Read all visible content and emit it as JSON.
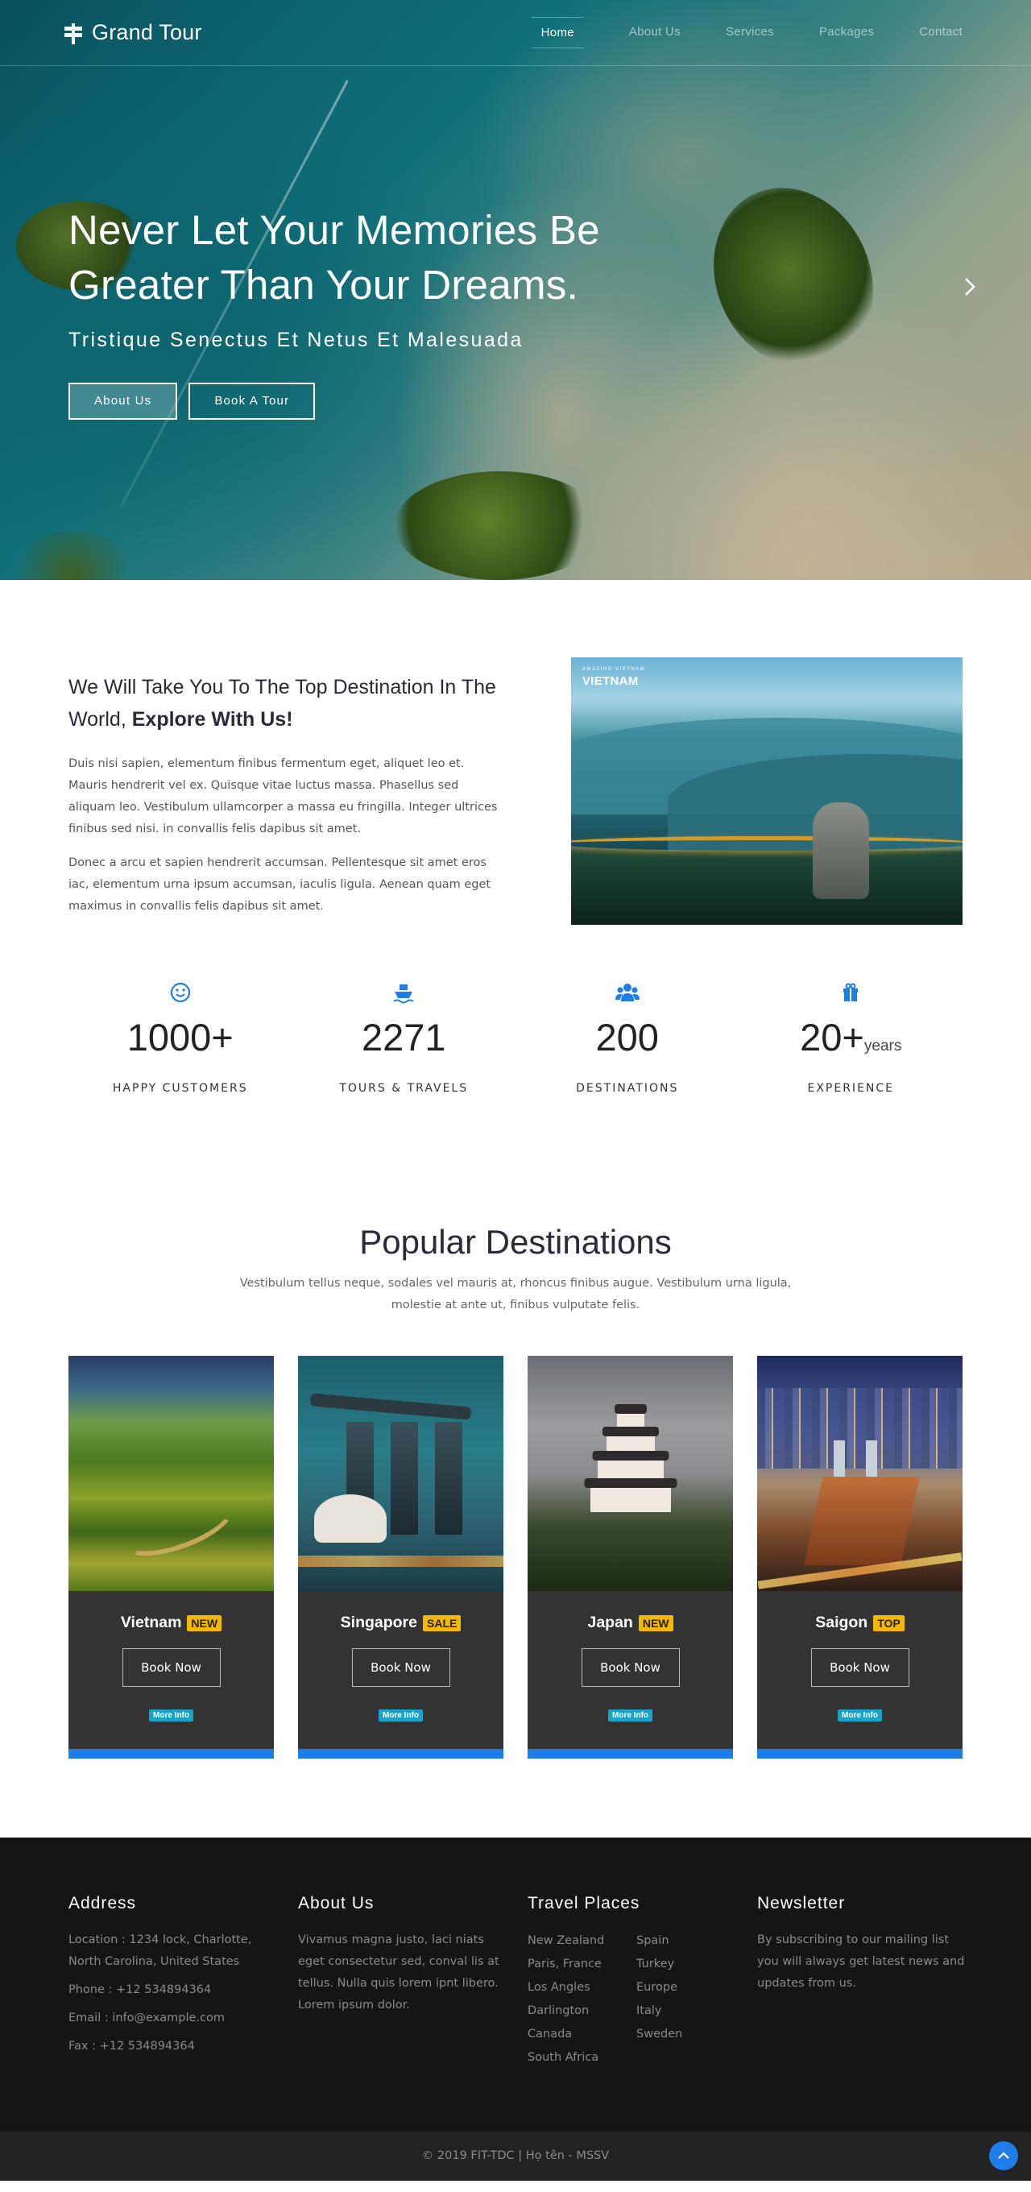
{
  "brand": {
    "name": "Grand Tour",
    "icon": "signpost-icon"
  },
  "nav": {
    "items": [
      {
        "label": "Home",
        "active": true
      },
      {
        "label": "About Us",
        "active": false
      },
      {
        "label": "Services",
        "active": false
      },
      {
        "label": "Packages",
        "active": false
      },
      {
        "label": "Contact",
        "active": false
      }
    ]
  },
  "hero": {
    "title_line1": "Never Let Your Memories Be",
    "title_line2": "Greater Than Your Dreams.",
    "subtitle": "Tristique Senectus Et Netus Et Malesuada",
    "buttons": {
      "about": "About Us",
      "book": "Book A Tour"
    },
    "next_icon": "chevron-right-icon"
  },
  "about": {
    "heading_part1": "We Will Take You To The Top Destination In The World, ",
    "heading_strong": "Explore With Us!",
    "paragraph1": "Duis nisi sapien, elementum finibus fermentum eget, aliquet leo et. Mauris hendrerit vel ex. Quisque vitae luctus massa. Phasellus sed aliquam leo. Vestibulum ullamcorper a massa eu fringilla. Integer ultrices finibus sed nisi. in convallis felis dapibus sit amet.",
    "paragraph2": "Donec a arcu et sapien hendrerit accumsan. Pellentesque sit amet eros iac, elementum urna ipsum accumsan, iaculis ligula. Aenean quam eget maximus in convallis felis dapibus sit amet.",
    "image_label_small": "AMAZING VIETNAM",
    "image_label": "VIETNAM"
  },
  "stats": [
    {
      "icon": "smile-icon",
      "number": "1000+",
      "unit": "",
      "label": "HAPPY CUSTOMERS"
    },
    {
      "icon": "ship-icon",
      "number": "2271",
      "unit": "",
      "label": "TOURS & TRAVELS"
    },
    {
      "icon": "users-icon",
      "number": "200",
      "unit": "",
      "label": "DESTINATIONS"
    },
    {
      "icon": "gift-icon",
      "number": "20+",
      "unit": "years",
      "label": "EXPERIENCE"
    }
  ],
  "destinations": {
    "title": "Popular Destinations",
    "subtitle": "Vestibulum tellus neque, sodales vel mauris at, rhoncus finibus augue. Vestibulum urna ligula, molestie at ante ut, finibus vulputate felis.",
    "cards": [
      {
        "name": "Vietnam",
        "badge": "NEW",
        "button": "Book Now",
        "info": "More Info"
      },
      {
        "name": "Singapore",
        "badge": "SALE",
        "button": "Book Now",
        "info": "More Info"
      },
      {
        "name": "Japan",
        "badge": "NEW",
        "button": "Book Now",
        "info": "More Info"
      },
      {
        "name": "Saigon",
        "badge": "TOP",
        "button": "Book Now",
        "info": "More Info"
      }
    ]
  },
  "footer": {
    "address": {
      "title": "Address",
      "location": "Location : 1234 lock, Charlotte, North Carolina, United States",
      "phone": "Phone : +12 534894364",
      "email": "Email : info@example.com",
      "fax": "Fax : +12 534894364"
    },
    "about": {
      "title": "About Us",
      "text": "Vivamus magna justo, laci niats eget consectetur sed, conval lis at tellus. Nulla quis lorem ipnt libero. Lorem ipsum dolor."
    },
    "places": {
      "title": "Travel Places",
      "col1": [
        "New Zealand",
        "Paris, France",
        "Los Angles",
        "Darlington",
        "Canada",
        "South Africa"
      ],
      "col2": [
        "Spain",
        "Turkey",
        "Europe",
        "Italy",
        "Sweden"
      ]
    },
    "newsletter": {
      "title": "Newsletter",
      "text": "By subscribing to our mailing list you will always get latest news and updates from us."
    }
  },
  "copyright": "© 2019 FIT-TDC | Họ tên - MSSV",
  "colors": {
    "accent": "#1e7de8",
    "badge": "#f5b800",
    "info": "#1aa3c7",
    "footer_bg": "#151515"
  }
}
